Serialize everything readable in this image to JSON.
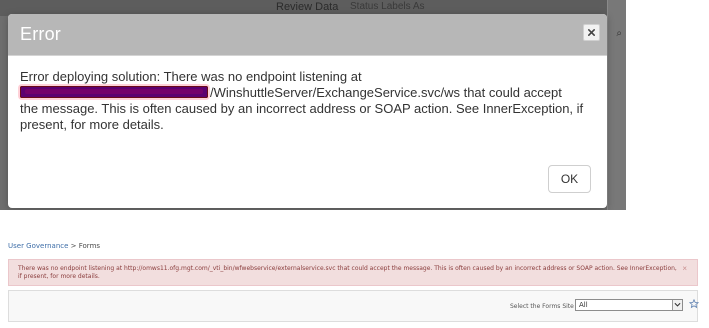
{
  "dialog": {
    "title": "Error",
    "message_line_1": "Error deploying solution: There was no endpoint listening at",
    "message_line_2": "/WinshuttleServer/ExchangeService.svc/ws that could accept",
    "message_line_3": "the message. This is often caused by an incorrect address or SOAP action. See InnerException, if",
    "message_line_4": "present, for more details.",
    "ok_label": "OK"
  },
  "background_app": {
    "tab_label": "Review Data",
    "tab_label_2": "Status Labels As"
  },
  "breadcrumb": {
    "root": "User Governance",
    "separator": " > ",
    "current": "Forms"
  },
  "error_banner": {
    "text": "There was no endpoint listening at http://omws11.ofg.mgt.com/_vti_bin/wfwebservice/externalservice.svc that could accept the message. This is often caused by an incorrect address or SOAP action. See InnerException, if present, for more details.",
    "close_symbol": "×"
  },
  "forms_filter": {
    "label": "Select the Forms Site",
    "selected_value": "All"
  },
  "colors": {
    "modal_header": "#b7b7b7",
    "error_background": "#f2dede",
    "error_text": "#8a3d3d",
    "breadcrumb_link": "#3e6ea8"
  },
  "icons": {
    "dialog_close": "close-icon",
    "select_arrow": "chevron-down-icon",
    "favorite": "star-icon"
  }
}
